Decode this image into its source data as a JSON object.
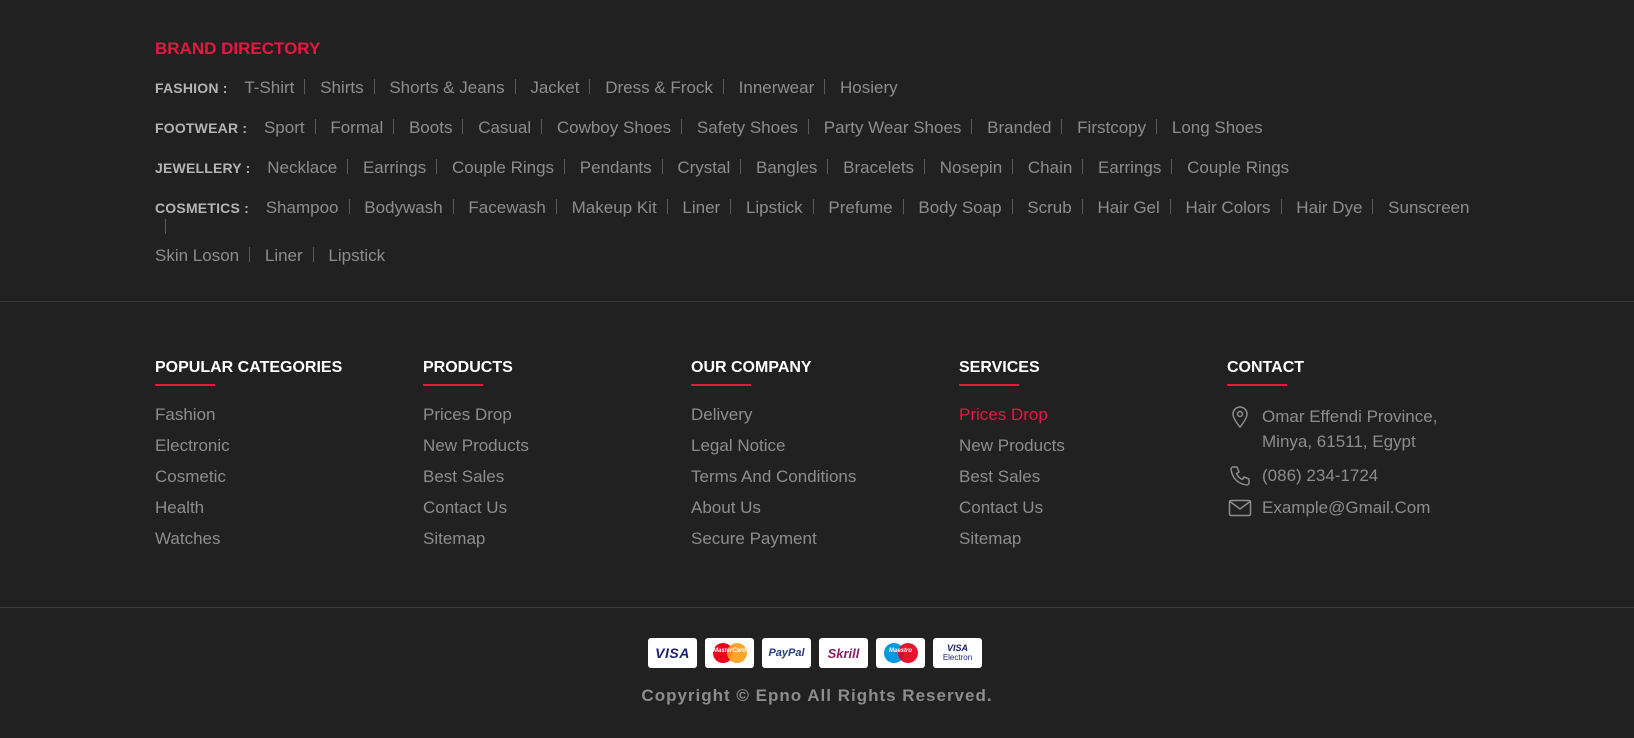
{
  "brand_directory": {
    "title": "BRAND DIRECTORY",
    "rows": [
      {
        "category": "FASHION :",
        "links": [
          "T-Shirt",
          "Shirts",
          "Shorts & Jeans",
          "Jacket",
          "Dress & Frock",
          "Innerwear",
          "Hosiery"
        ]
      },
      {
        "category": "FOOTWEAR :",
        "links": [
          "Sport",
          "Formal",
          "Boots",
          "Casual",
          "Cowboy Shoes",
          "Safety Shoes",
          "Party Wear Shoes",
          "Branded",
          "Firstcopy",
          "Long Shoes"
        ]
      },
      {
        "category": "JEWELLERY :",
        "links": [
          "Necklace",
          "Earrings",
          "Couple Rings",
          "Pendants",
          "Crystal",
          "Bangles",
          "Bracelets",
          "Nosepin",
          "Chain",
          "Earrings",
          "Couple Rings"
        ]
      },
      {
        "category": "COSMETICS :",
        "links": [
          "Shampoo",
          "Bodywash",
          "Facewash",
          "Makeup Kit",
          "Liner",
          "Lipstick",
          "Prefume",
          "Body Soap",
          "Scrub",
          "Hair Gel",
          "Hair Colors",
          "Hair Dye",
          "Sunscreen"
        ],
        "links_wrap": [
          "Skin Loson",
          "Liner",
          "Lipstick"
        ]
      }
    ]
  },
  "columns": {
    "popular": {
      "title": "POPULAR CATEGORIES",
      "items": [
        "Fashion",
        "Electronic",
        "Cosmetic",
        "Health",
        "Watches"
      ]
    },
    "products": {
      "title": "PRODUCTS",
      "items": [
        "Prices Drop",
        "New Products",
        "Best Sales",
        "Contact Us",
        "Sitemap"
      ]
    },
    "company": {
      "title": "OUR COMPANY",
      "items": [
        "Delivery",
        "Legal Notice",
        "Terms And Conditions",
        "About Us",
        "Secure Payment"
      ]
    },
    "services": {
      "title": "SERVICES",
      "items": [
        "Prices Drop",
        "New Products",
        "Best Sales",
        "Contact Us",
        "Sitemap"
      ]
    },
    "contact": {
      "title": "CONTACT",
      "address_line1": "Omar Effendi Province,",
      "address_line2": "Minya, 61511, Egypt",
      "phone": "(086) 234-1724",
      "email": "Example@Gmail.Com"
    }
  },
  "payments": {
    "visa": "VISA",
    "mastercard": "MasterCard",
    "paypal": "PayPal",
    "skrill": "Skrill",
    "maestro": "Maestro",
    "visa_electron_top": "VISA",
    "visa_electron_bottom": "Electron"
  },
  "copyright": "Copyright © Epno All Rights Reserved.",
  "colors": {
    "accent": "#e8173f",
    "background": "#212121",
    "text": "#8d8d8d"
  }
}
